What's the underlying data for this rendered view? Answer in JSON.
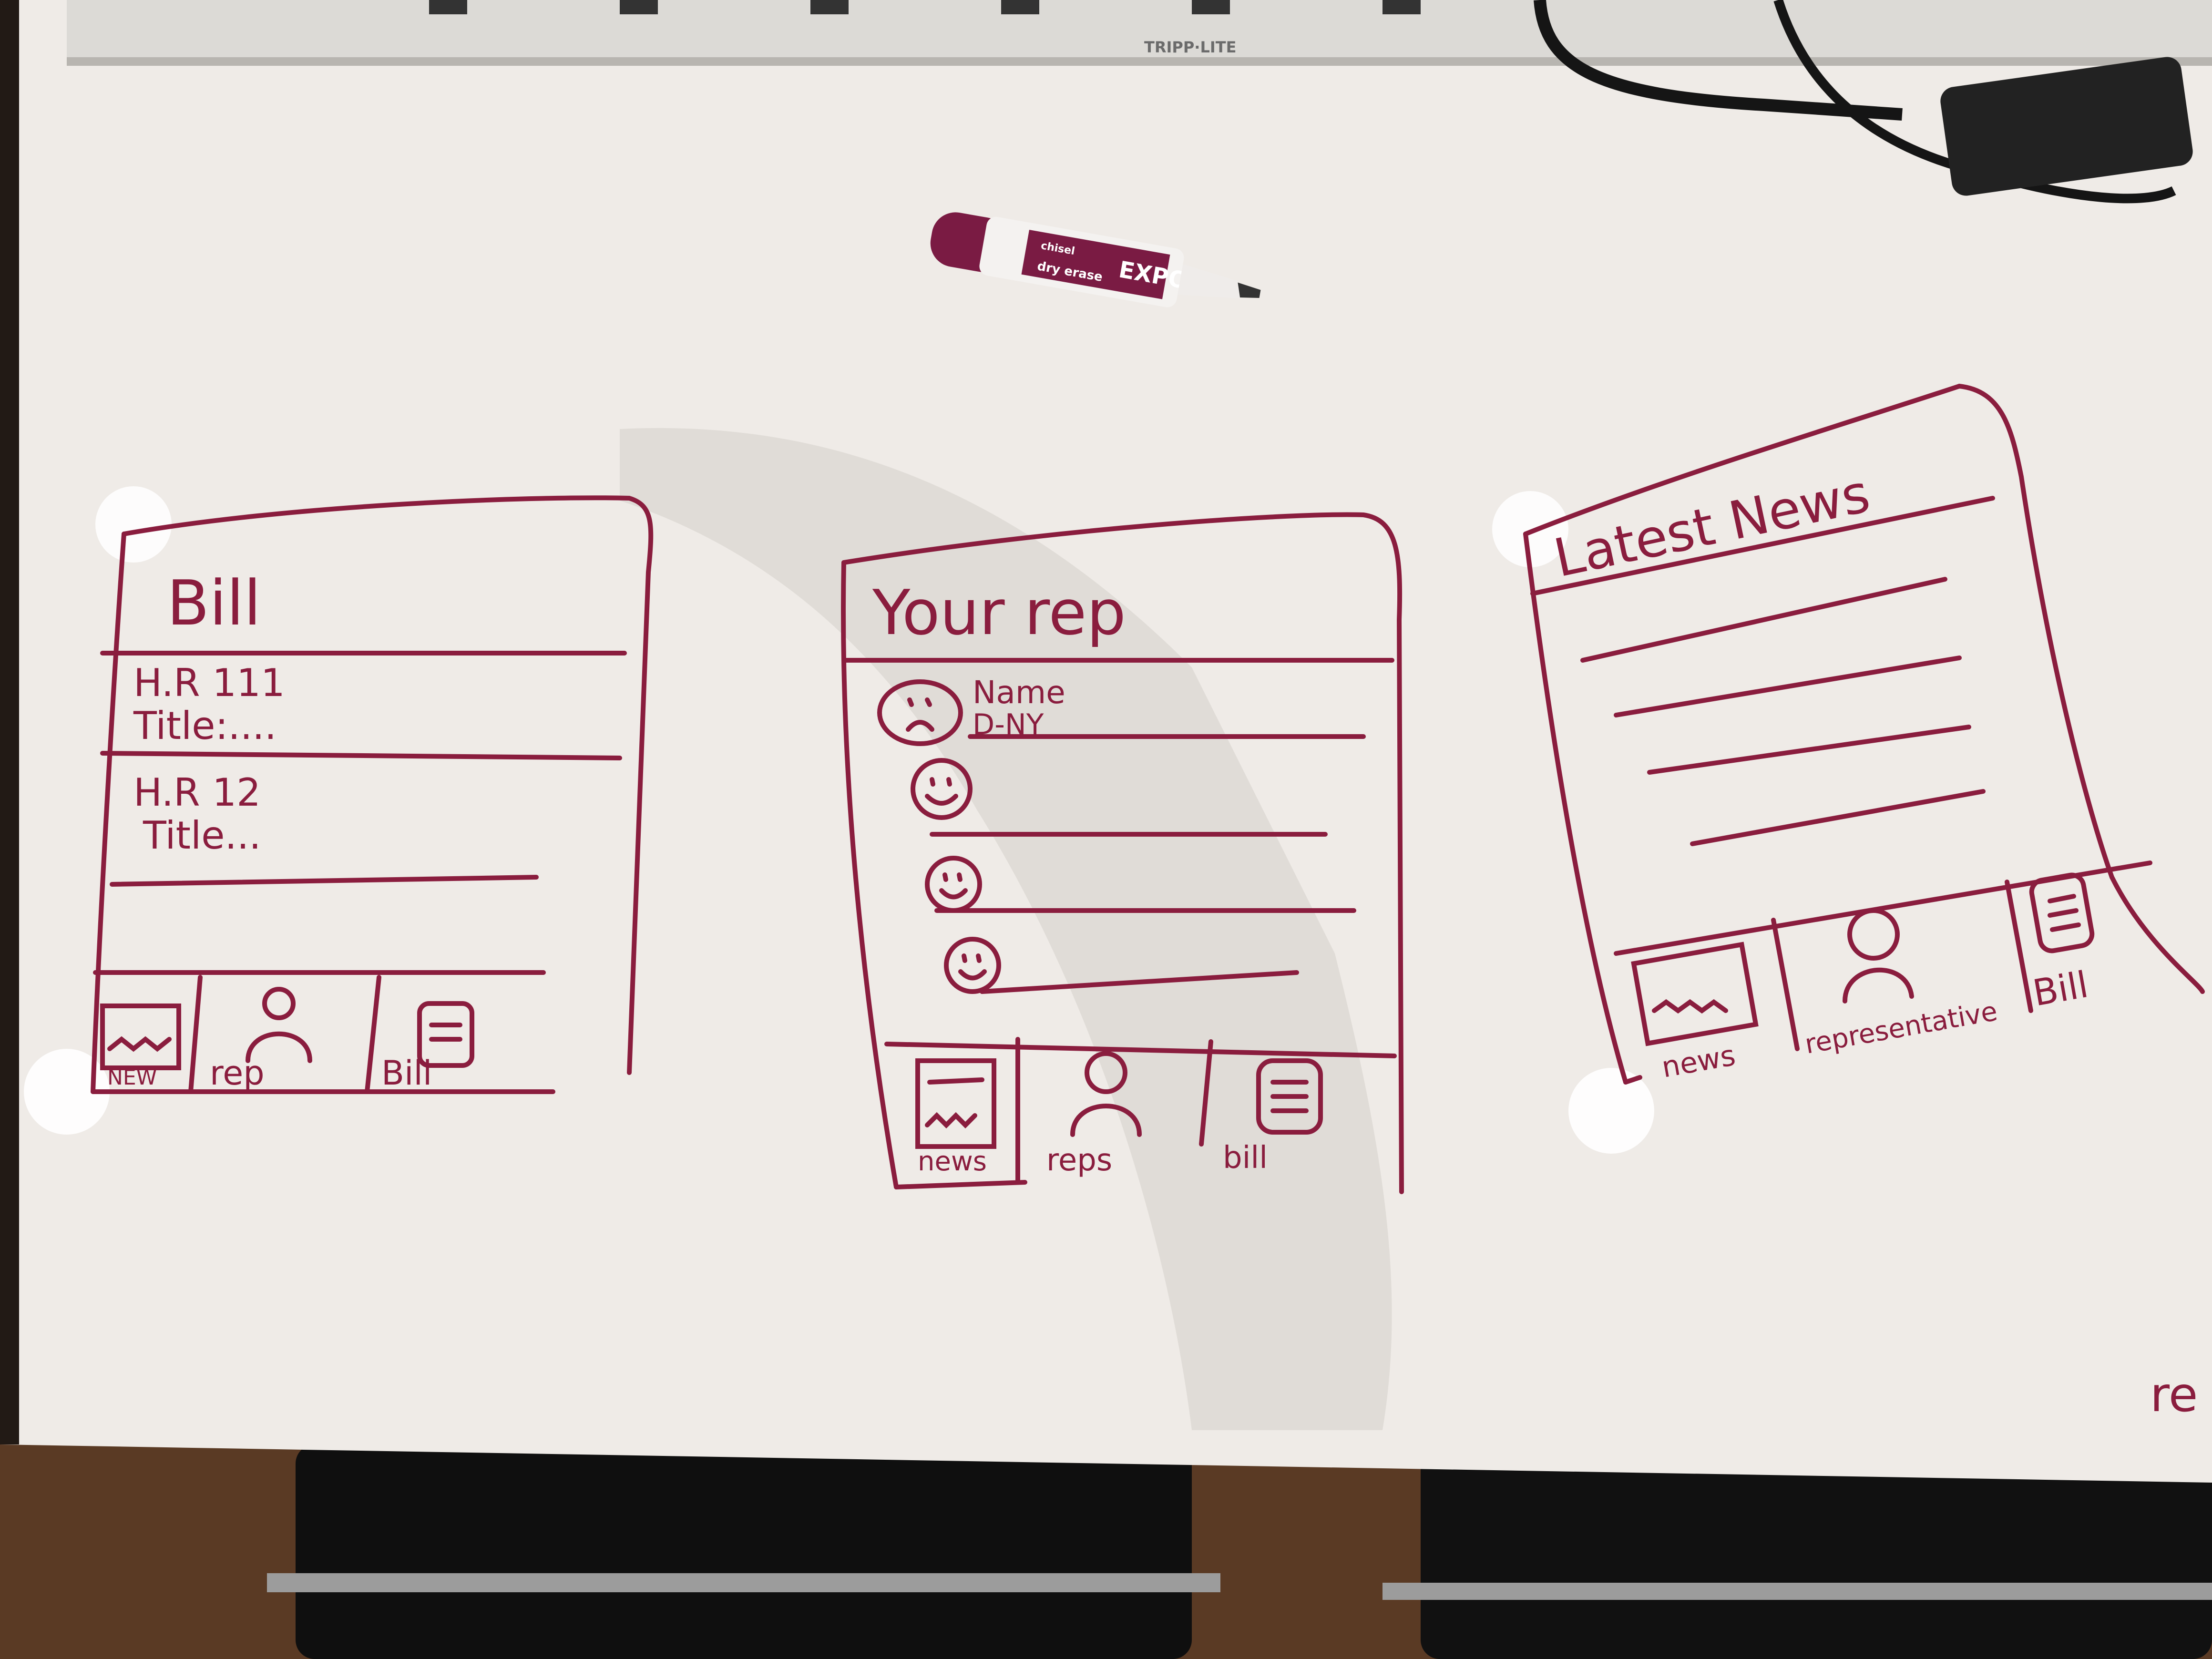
{
  "colors": {
    "ink": "#8a1d3e",
    "board": "#efebe7",
    "board_shadow": "#d8d3ce",
    "floor": "#5a3a24",
    "chair": "#111111",
    "power_strip": "#dcdad6",
    "adapter": "#222222",
    "marker_cap": "#7a1b43"
  },
  "power_strip": {
    "brand": "TRIPP·LITE"
  },
  "marker": {
    "brand": "EXPO",
    "line": "dry erase",
    "tip": "chisel"
  },
  "corner_text": "re",
  "sketches": {
    "bill": {
      "title": "Bill",
      "items": [
        {
          "id": "H.R 111",
          "title": "Title:...."
        },
        {
          "id": "H.R 12",
          "title": "Title..."
        }
      ],
      "tabs": [
        "NEW",
        "rep",
        "Bill"
      ]
    },
    "your_rep": {
      "title": "Your rep",
      "first_rep": {
        "name": "Name",
        "party": "D-NY"
      },
      "face_icons": [
        "sad-face-icon",
        "smiley-face-icon",
        "smiley-face-icon",
        "smiley-face-icon"
      ],
      "tabs": [
        "news",
        "reps",
        "bill"
      ]
    },
    "latest_news": {
      "title": "Latest News",
      "tabs": [
        "news",
        "representative",
        "Bill"
      ]
    }
  }
}
